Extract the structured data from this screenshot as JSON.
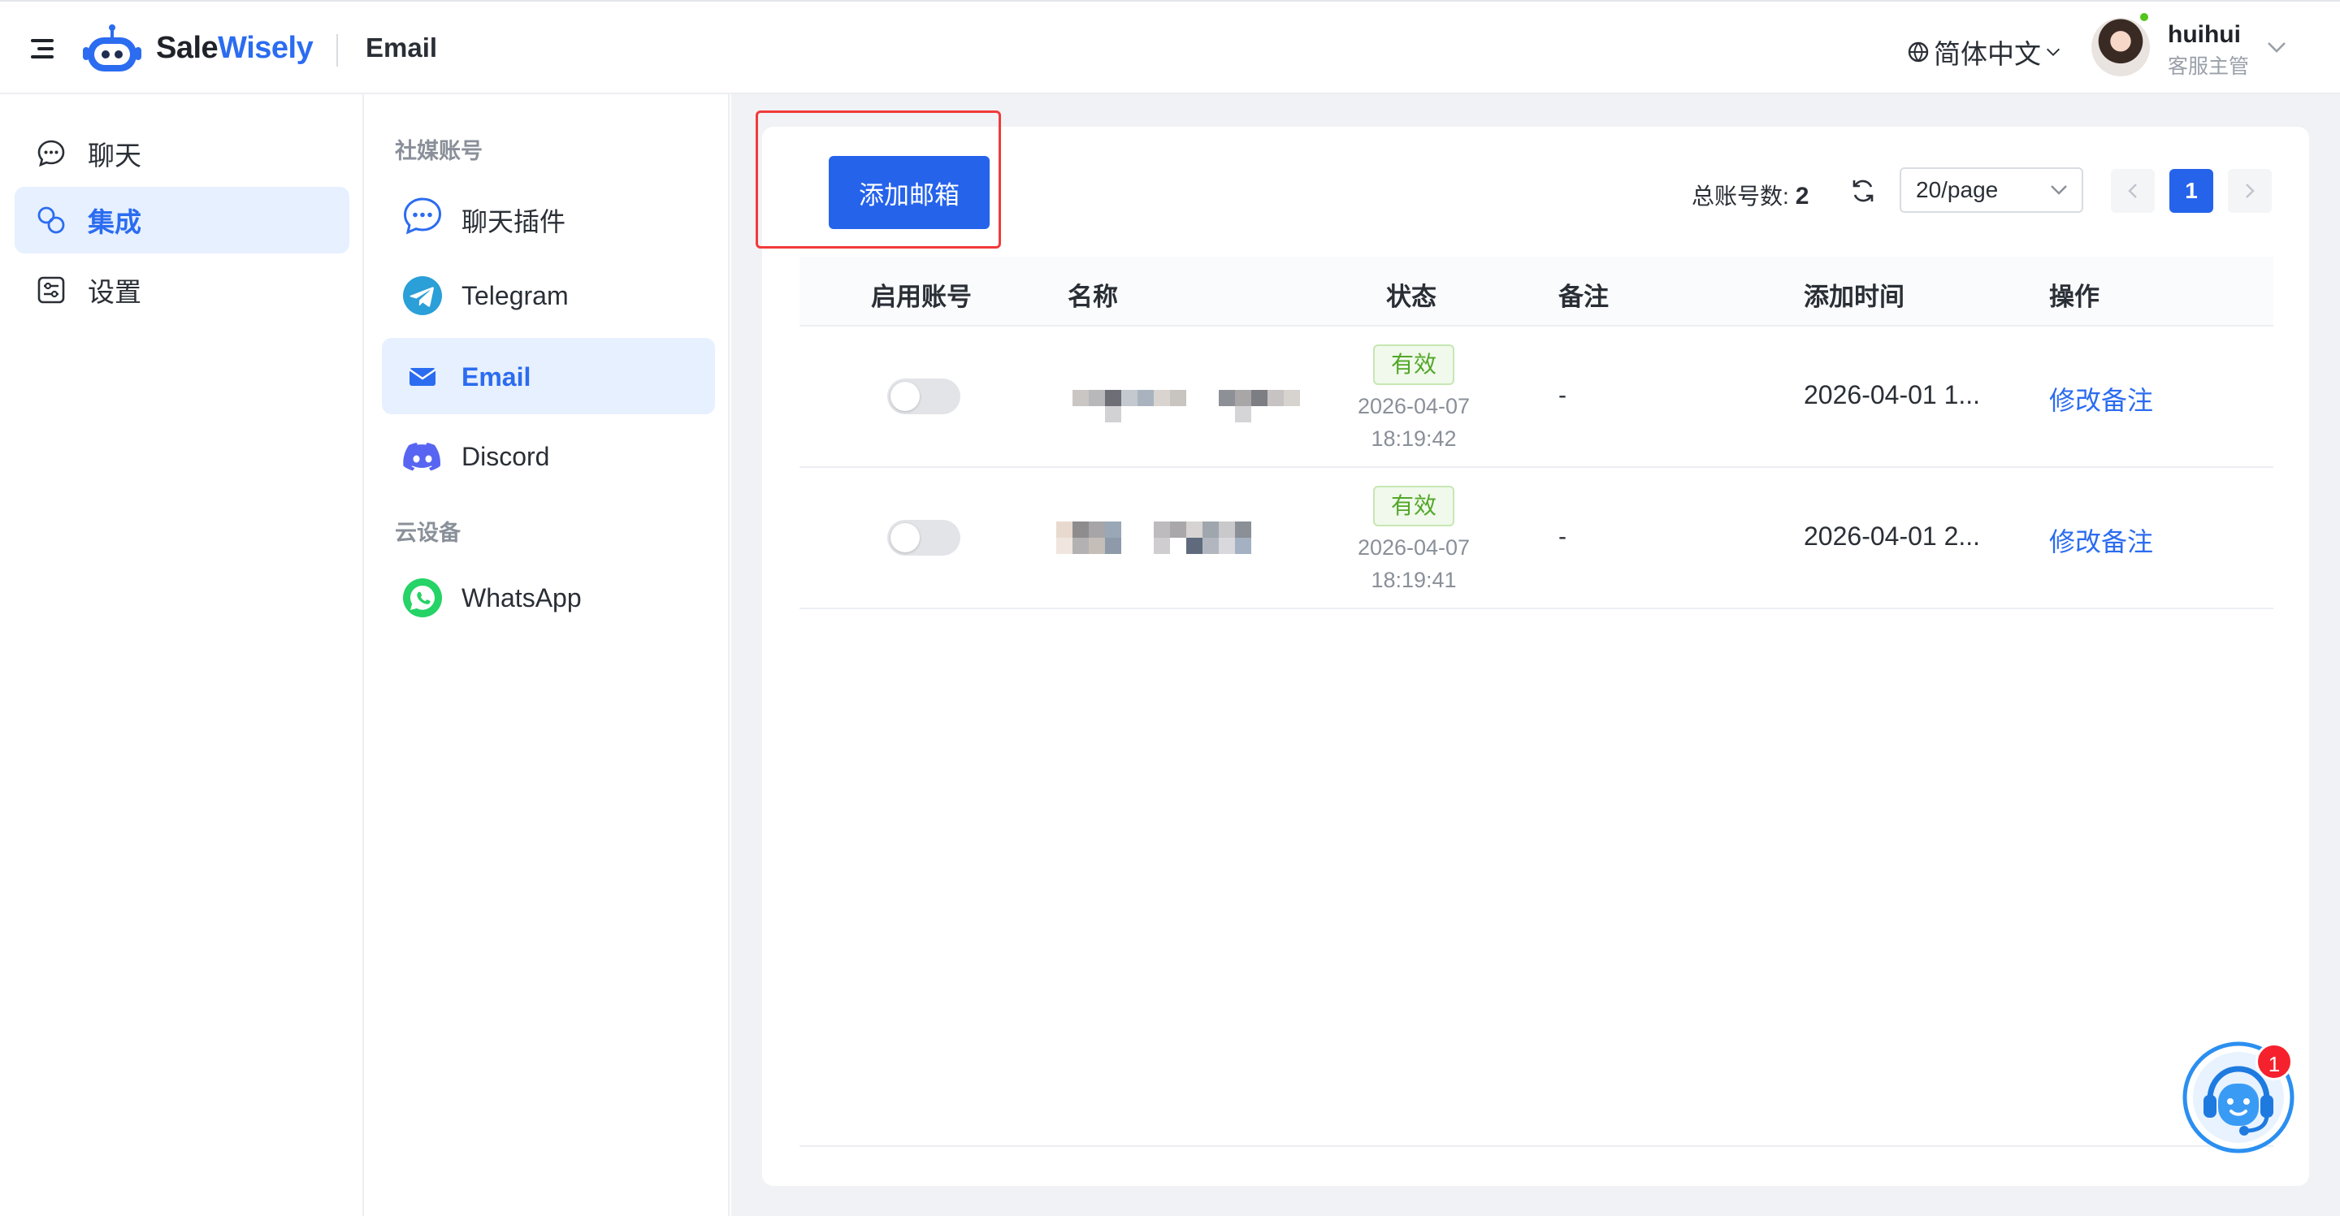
{
  "header": {
    "brand_sale": "Sale",
    "brand_wisely": "Wisely",
    "page_title": "Email",
    "language": "简体中文",
    "user_name": "huihui",
    "user_role": "客服主管"
  },
  "left_nav": {
    "items": [
      {
        "label": "聊天",
        "icon": "chat-bubble-icon",
        "active": false
      },
      {
        "label": "集成",
        "icon": "integration-icon",
        "active": true
      },
      {
        "label": "设置",
        "icon": "settings-icon",
        "active": false
      }
    ]
  },
  "sub_nav": {
    "group_social": "社媒账号",
    "group_cloud": "云设备",
    "items": [
      {
        "label": "聊天插件",
        "icon": "chat-plugin-icon"
      },
      {
        "label": "Telegram",
        "icon": "telegram-icon"
      },
      {
        "label": "Email",
        "icon": "email-icon",
        "active": true
      },
      {
        "label": "Discord",
        "icon": "discord-icon"
      },
      {
        "label": "WhatsApp",
        "icon": "whatsapp-icon"
      }
    ]
  },
  "toolbar": {
    "add_button": "添加邮箱",
    "total_label": "总账号数:",
    "total_value": "2",
    "page_size": "20/page",
    "current_page": "1"
  },
  "table": {
    "columns": [
      "启用账号",
      "名称",
      "状态",
      "备注",
      "添加时间",
      "操作"
    ],
    "rows": [
      {
        "enabled": false,
        "status": "有效",
        "status_date": "2026-04-07",
        "status_time": "18:19:42",
        "remark": "-",
        "added": "2026-04-01 1...",
        "action": "修改备注"
      },
      {
        "enabled": false,
        "status": "有效",
        "status_date": "2026-04-07",
        "status_time": "18:19:41",
        "remark": "-",
        "added": "2026-04-01 2...",
        "action": "修改备注"
      }
    ]
  },
  "support": {
    "badge": "1"
  },
  "colors": {
    "accent": "#2563eb",
    "link": "#2b6cf0",
    "success": "#52a728",
    "highlight": "#f23a3a"
  }
}
